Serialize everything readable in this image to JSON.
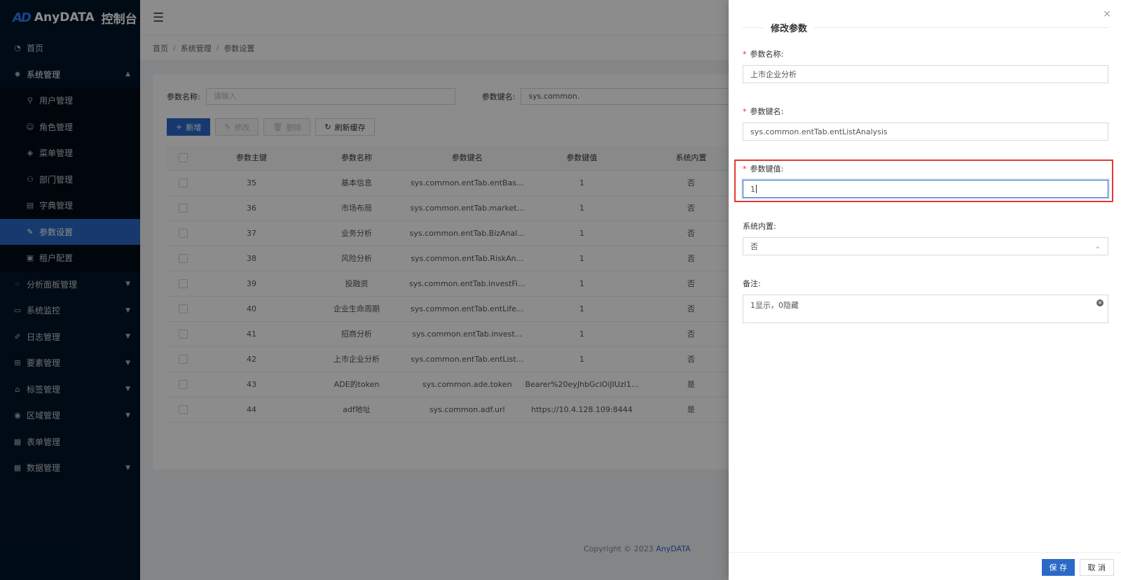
{
  "app": {
    "logo_mark": "AD",
    "title": "AnyDATA",
    "subtitle": "控制台"
  },
  "sidebar": {
    "items": [
      {
        "label": "首页",
        "icon": "dashboard-icon"
      },
      {
        "label": "系统管理",
        "icon": "gear-icon"
      },
      {
        "label": "分析面板管理",
        "icon": "grid-icon"
      },
      {
        "label": "系统监控",
        "icon": "monitor-icon"
      },
      {
        "label": "日志管理",
        "icon": "log-icon"
      },
      {
        "label": "要素管理",
        "icon": "element-icon"
      },
      {
        "label": "标签管理",
        "icon": "tag-icon"
      },
      {
        "label": "区域管理",
        "icon": "location-icon"
      },
      {
        "label": "表单管理",
        "icon": "form-icon"
      },
      {
        "label": "数据管理",
        "icon": "database-icon"
      }
    ],
    "submenu": [
      {
        "label": "用户管理",
        "icon": "user-icon"
      },
      {
        "label": "角色管理",
        "icon": "role-icon"
      },
      {
        "label": "菜单管理",
        "icon": "menu-icon"
      },
      {
        "label": "部门管理",
        "icon": "department-icon"
      },
      {
        "label": "字典管理",
        "icon": "dictionary-icon"
      },
      {
        "label": "参数设置",
        "icon": "edit-icon"
      },
      {
        "label": "租户配置",
        "icon": "tenant-icon"
      }
    ]
  },
  "breadcrumb": [
    "首页",
    "系统管理",
    "参数设置"
  ],
  "filter": {
    "name_label": "参数名称:",
    "name_placeholder": "请输入",
    "key_label": "参数键名:",
    "key_value": "sys.common."
  },
  "toolbar": {
    "add": "新增",
    "edit": "修改",
    "delete": "删除",
    "refresh": "刷新缓存"
  },
  "table": {
    "headers": [
      "参数主键",
      "参数名称",
      "参数键名",
      "参数键值",
      "系统内置"
    ],
    "rows": [
      [
        "35",
        "基本信息",
        "sys.common.entTab.entBas...",
        "1",
        "否"
      ],
      [
        "36",
        "市场布局",
        "sys.common.entTab.market...",
        "1",
        "否"
      ],
      [
        "37",
        "业务分析",
        "sys.common.entTab.BizAnal...",
        "1",
        "否"
      ],
      [
        "38",
        "风险分析",
        "sys.common.entTab.RiskAn...",
        "1",
        "否"
      ],
      [
        "39",
        "投融资",
        "sys.common.entTab.investFi...",
        "1",
        "否"
      ],
      [
        "40",
        "企业生命周期",
        "sys.common.entTab.entLife...",
        "1",
        "否"
      ],
      [
        "41",
        "招商分析",
        "sys.common.entTab.invest...",
        "1",
        "否"
      ],
      [
        "42",
        "上市企业分析",
        "sys.common.entTab.entList...",
        "1",
        "否"
      ],
      [
        "43",
        "ADE的token",
        "sys.common.ade.token",
        "Bearer%20eyJhbGciOiJIUzI1...",
        "是"
      ],
      [
        "44",
        "adf地址",
        "sys.common.adf.url",
        "https://10.4.128.109:8444",
        "是"
      ]
    ]
  },
  "footer": {
    "copyright": "Copyright © 2023",
    "brand": "AnyDATA"
  },
  "drawer": {
    "title": "修改参数",
    "close": "×",
    "required_mark": "*",
    "fields": {
      "name": {
        "label": "参数名称:",
        "value": "上市企业分析"
      },
      "key": {
        "label": "参数键名:",
        "value": "sys.common.entTab.entListAnalysis"
      },
      "val": {
        "label": "参数键值:",
        "value": "1"
      },
      "builtin": {
        "label": "系统内置:",
        "value": "否"
      },
      "remark": {
        "label": "备注:",
        "value": "1显示，0隐藏"
      }
    },
    "save": "保 存",
    "cancel": "取 消"
  },
  "colors": {
    "primary": "#2a69c7",
    "sidebar_bg": "#001529",
    "highlight": "#e53935",
    "required": "#f5222d"
  }
}
